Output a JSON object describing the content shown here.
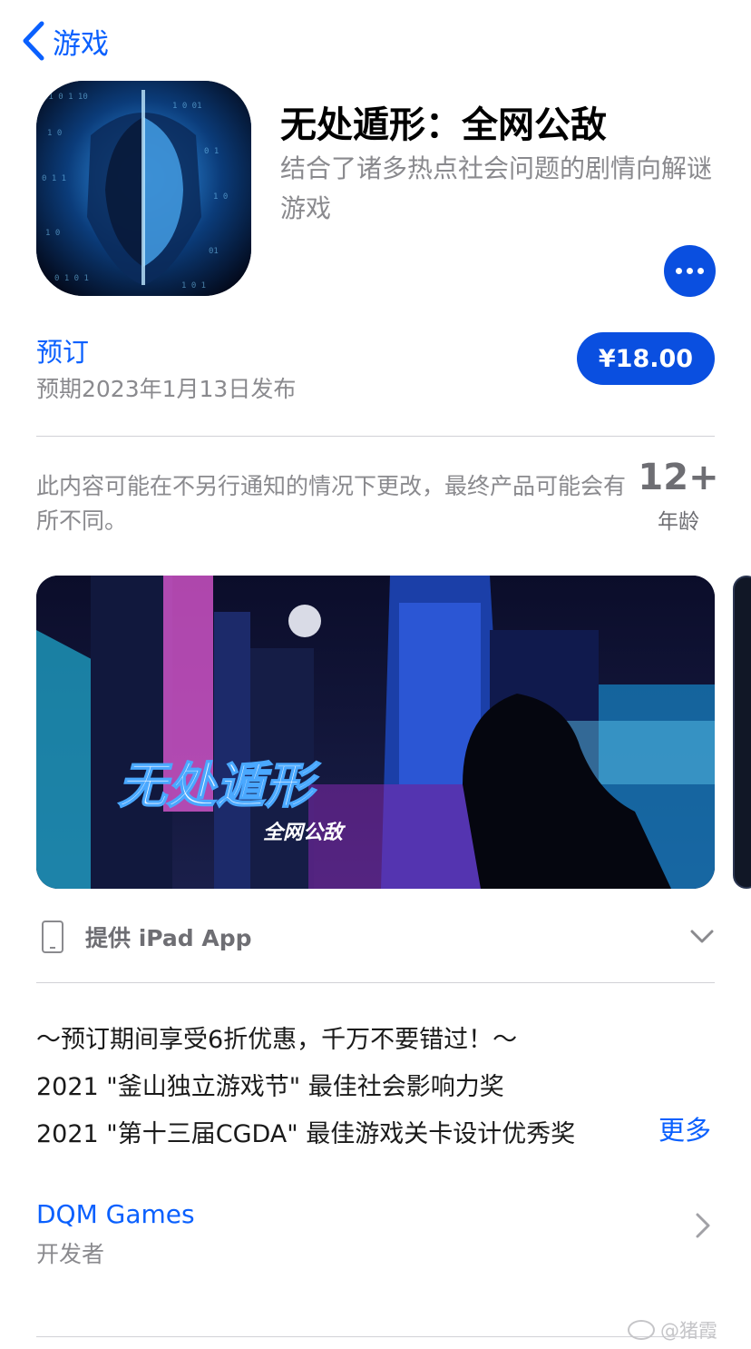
{
  "nav": {
    "back_label": "游戏"
  },
  "app": {
    "title": "无处遁形：全网公敌",
    "subtitle": "结合了诸多热点社会问题的剧情向解谜游戏"
  },
  "purchase": {
    "preorder_label": "预订",
    "release_date": "预期2023年1月13日发布",
    "price": "¥18.00"
  },
  "notice": {
    "text": "此内容可能在不另行通知的情况下更改，最终产品可能会有所不同。"
  },
  "age_rating": {
    "value": "12+",
    "label": "年龄"
  },
  "screenshot": {
    "logo_title": "无处遁形",
    "logo_subtitle": "全网公敌"
  },
  "ipad": {
    "label": "提供 iPad App"
  },
  "description": {
    "lines": [
      "～预订期间享受6折优惠，千万不要错过！～",
      "2021 \"釜山独立游戏节\" 最佳社会影响力奖",
      "2021 \"第十三届CGDA\" 最佳游戏关卡设计优秀奖"
    ],
    "more_label": "更多"
  },
  "developer": {
    "name": "DQM Games",
    "role": "开发者"
  },
  "watermark": {
    "text": "@猪霞"
  },
  "colors": {
    "accent": "#0a60fe",
    "button": "#0a4fe0",
    "secondary_text": "#8a8a8e"
  }
}
